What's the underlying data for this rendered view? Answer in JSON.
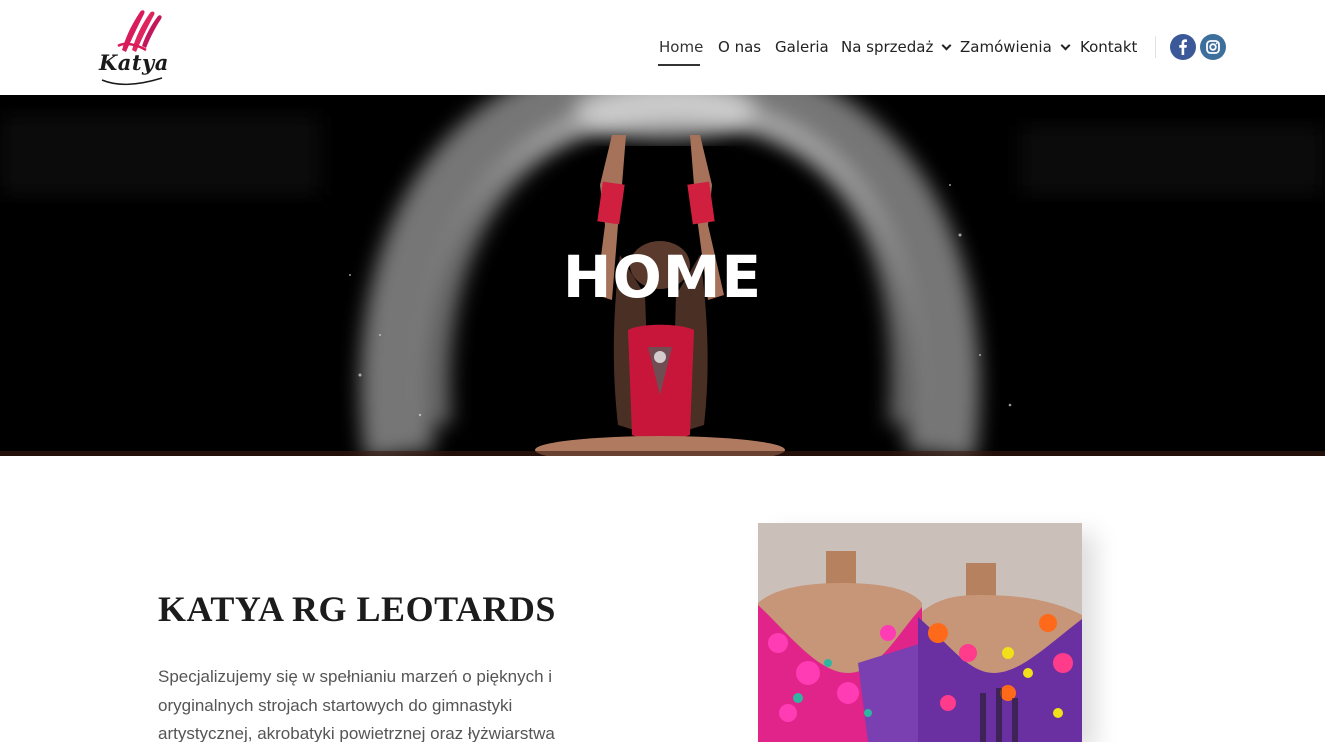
{
  "header": {
    "logo_text": "Katya",
    "nav": [
      {
        "label": "Home",
        "active": true,
        "dropdown": false
      },
      {
        "label": "O nas",
        "active": false,
        "dropdown": false
      },
      {
        "label": "Galeria",
        "active": false,
        "dropdown": false
      },
      {
        "label": "Na sprzedaż",
        "active": false,
        "dropdown": true
      },
      {
        "label": "Zamówienia",
        "active": false,
        "dropdown": true
      },
      {
        "label": "Kontakt",
        "active": false,
        "dropdown": false
      }
    ],
    "social": [
      {
        "name": "facebook-icon",
        "color": "#3b5998"
      },
      {
        "name": "instagram-icon",
        "color": "#3d6f9c"
      }
    ]
  },
  "hero": {
    "title": "HOME",
    "background": "#000000"
  },
  "intro": {
    "title": "KATYA RG LEOTARDS",
    "text": "Specjalizujemy się w spełnianiu marzeń o pięknych i oryginalnych strojach startowych do gimnastyki artystycznej, akrobatyki powietrznej oraz łyżwiarstwa"
  },
  "colors": {
    "accent_pink": "#e0245e",
    "text_dark": "#1c1c1c",
    "text_body": "#555555"
  }
}
